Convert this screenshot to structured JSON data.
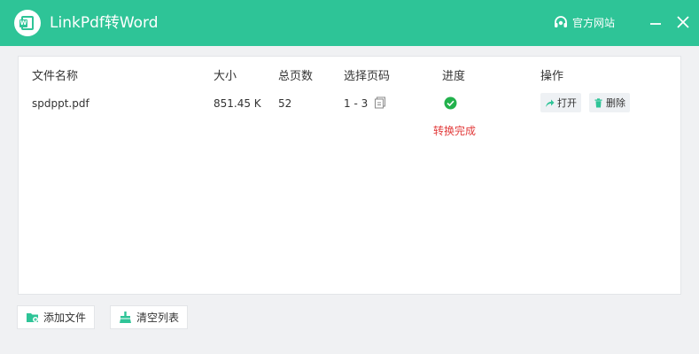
{
  "window": {
    "title": "LinkPdf转Word",
    "site_link": "官方网站"
  },
  "table": {
    "columns": [
      "文件名称",
      "大小",
      "总页数",
      "选择页码",
      "进度",
      "操作"
    ],
    "rows": [
      {
        "name": "spdppt.pdf",
        "size": "851.45 K",
        "pages": "52",
        "range": "1 - 3",
        "status": "转换完成",
        "open_label": "打开",
        "delete_label": "删除"
      }
    ]
  },
  "footer": {
    "add_label": "添加文件",
    "clear_label": "清空列表"
  },
  "colors": {
    "accent": "#2ec497",
    "status_error": "#e23b3b",
    "success": "#22b14c"
  }
}
